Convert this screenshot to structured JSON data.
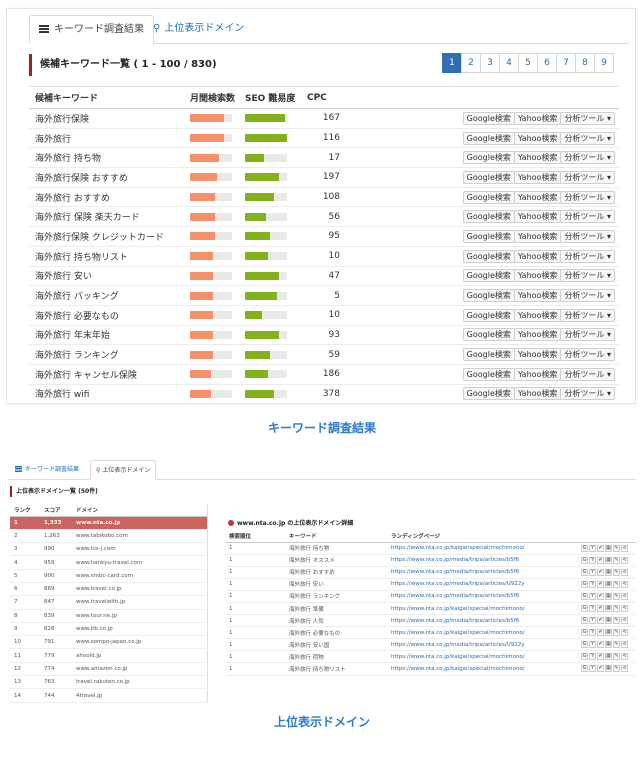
{
  "panel1": {
    "tabs": [
      {
        "label": "キーワード調査結果",
        "icon": "list-icon"
      },
      {
        "label": "上位表示ドメイン",
        "icon": "map-pin-icon"
      }
    ],
    "section_title": "候補キーワード一覧 ( 1 - 100 / 830)",
    "pagination": [
      "1",
      "2",
      "3",
      "4",
      "5",
      "6",
      "7",
      "8",
      "9"
    ],
    "columns": [
      "候補キーワード",
      "月間検索数",
      "SEO 難易度",
      "CPC"
    ],
    "buttons": {
      "google": "Google検索",
      "yahoo": "Yahoo検索",
      "tools": "分析ツール ▾"
    },
    "rows": [
      {
        "keyword": "海外旅行保険",
        "volume": 0.8,
        "seo": 0.95,
        "cpc": "167"
      },
      {
        "keyword": "海外旅行",
        "volume": 0.8,
        "seo": 1.0,
        "cpc": "116"
      },
      {
        "keyword": "海外旅行 持ち物",
        "volume": 0.7,
        "seo": 0.45,
        "cpc": "17"
      },
      {
        "keyword": "海外旅行保険 おすすめ",
        "volume": 0.65,
        "seo": 0.8,
        "cpc": "197"
      },
      {
        "keyword": "海外旅行 おすすめ",
        "volume": 0.6,
        "seo": 0.7,
        "cpc": "108"
      },
      {
        "keyword": "海外旅行 保険 楽天カード",
        "volume": 0.6,
        "seo": 0.5,
        "cpc": "56"
      },
      {
        "keyword": "海外旅行保険 クレジットカード",
        "volume": 0.6,
        "seo": 0.6,
        "cpc": "95"
      },
      {
        "keyword": "海外旅行 持ち物リスト",
        "volume": 0.55,
        "seo": 0.55,
        "cpc": "10"
      },
      {
        "keyword": "海外旅行 安い",
        "volume": 0.55,
        "seo": 0.8,
        "cpc": "47"
      },
      {
        "keyword": "海外旅行 パッキング",
        "volume": 0.55,
        "seo": 0.75,
        "cpc": "5"
      },
      {
        "keyword": "海外旅行 必要なもの",
        "volume": 0.55,
        "seo": 0.4,
        "cpc": "10"
      },
      {
        "keyword": "海外旅行 年末年始",
        "volume": 0.55,
        "seo": 0.8,
        "cpc": "93"
      },
      {
        "keyword": "海外旅行 ランキング",
        "volume": 0.55,
        "seo": 0.6,
        "cpc": "59"
      },
      {
        "keyword": "海外旅行 キャンセル保険",
        "volume": 0.5,
        "seo": 0.55,
        "cpc": "186"
      },
      {
        "keyword": "海外旅行 wifi",
        "volume": 0.5,
        "seo": 0.7,
        "cpc": "378"
      }
    ]
  },
  "caption1": "キーワード調査結果",
  "panel2": {
    "tabs": [
      {
        "label": "キーワード調査結果",
        "icon": "list-icon"
      },
      {
        "label": "上位表示ドメイン",
        "icon": "map-pin-icon"
      }
    ],
    "section_title": "上位表示ドメイン一覧 (50件)",
    "rank_columns": [
      "ランク",
      "スコア",
      "ドメイン"
    ],
    "ranks": [
      {
        "rank": "1",
        "score": "1,333",
        "domain": "www.nta.co.jp"
      },
      {
        "rank": "2",
        "score": "1,263",
        "domain": "www.tabikobo.com"
      },
      {
        "rank": "3",
        "score": "990",
        "domain": "www.his-j.com"
      },
      {
        "rank": "4",
        "score": "959",
        "domain": "www.hankyu-travel.com"
      },
      {
        "rank": "5",
        "score": "900",
        "domain": "www.smbc-card.com"
      },
      {
        "rank": "6",
        "score": "869",
        "domain": "www.travel.co.jp"
      },
      {
        "rank": "7",
        "score": "847",
        "domain": "www.travelwith.jp"
      },
      {
        "rank": "8",
        "score": "839",
        "domain": "www.tour.ne.jp"
      },
      {
        "rank": "9",
        "score": "828",
        "domain": "www.jtb.co.jp"
      },
      {
        "rank": "10",
        "score": "791",
        "domain": "www.sompo-japan.co.jp"
      },
      {
        "rank": "11",
        "score": "779",
        "domain": "ahoold.jp"
      },
      {
        "rank": "12",
        "score": "774",
        "domain": "www.amazon.co.jp"
      },
      {
        "rank": "13",
        "score": "763",
        "domain": "travel.rakuten.co.jp"
      },
      {
        "rank": "14",
        "score": "744",
        "domain": "4travel.jp"
      }
    ],
    "detail_title": "www.nta.co.jp の上位表示ドメイン詳細",
    "detail_columns": [
      "検索順位",
      "キーワード",
      "ランディングページ"
    ],
    "details": [
      {
        "pos": "1",
        "keyword": "海外旅行 持ち物",
        "url": "https://www.nta.co.jp/kaigai/special/mochimono/"
      },
      {
        "pos": "1",
        "keyword": "海外旅行 オススメ",
        "url": "https://www.nta.co.jp/media/tripa/articles/b5f6"
      },
      {
        "pos": "1",
        "keyword": "海外旅行 おすすめ",
        "url": "https://www.nta.co.jp/media/tripa/articles/b5f6"
      },
      {
        "pos": "1",
        "keyword": "海外旅行 安い",
        "url": "https://www.nta.co.jp/media/tripa/articles/U922y"
      },
      {
        "pos": "1",
        "keyword": "海外旅行 ランキング",
        "url": "https://www.nta.co.jp/media/tripa/articles/b5f6"
      },
      {
        "pos": "1",
        "keyword": "海外旅行 準備",
        "url": "https://www.nta.co.jp/kaigai/special/mochimono/"
      },
      {
        "pos": "1",
        "keyword": "海外旅行 人気",
        "url": "https://www.nta.co.jp/media/tripa/articles/b5f6"
      },
      {
        "pos": "1",
        "keyword": "海外旅行 必要なもの",
        "url": "https://www.nta.co.jp/kaigai/special/mochimono/"
      },
      {
        "pos": "1",
        "keyword": "海外旅行 安い国",
        "url": "https://www.nta.co.jp/media/tripa/articles/U922y"
      },
      {
        "pos": "1",
        "keyword": "海外旅行 荷物",
        "url": "https://www.nta.co.jp/kaigai/special/mochimono/"
      },
      {
        "pos": "1",
        "keyword": "海外旅行 持ち物リスト",
        "url": "https://www.nta.co.jp/kaigai/special/mochimono/"
      }
    ],
    "mini_buttons": [
      "G",
      "Y",
      "✔",
      "▦",
      "✎",
      "≺"
    ]
  },
  "caption2": "上位表示ドメイン"
}
